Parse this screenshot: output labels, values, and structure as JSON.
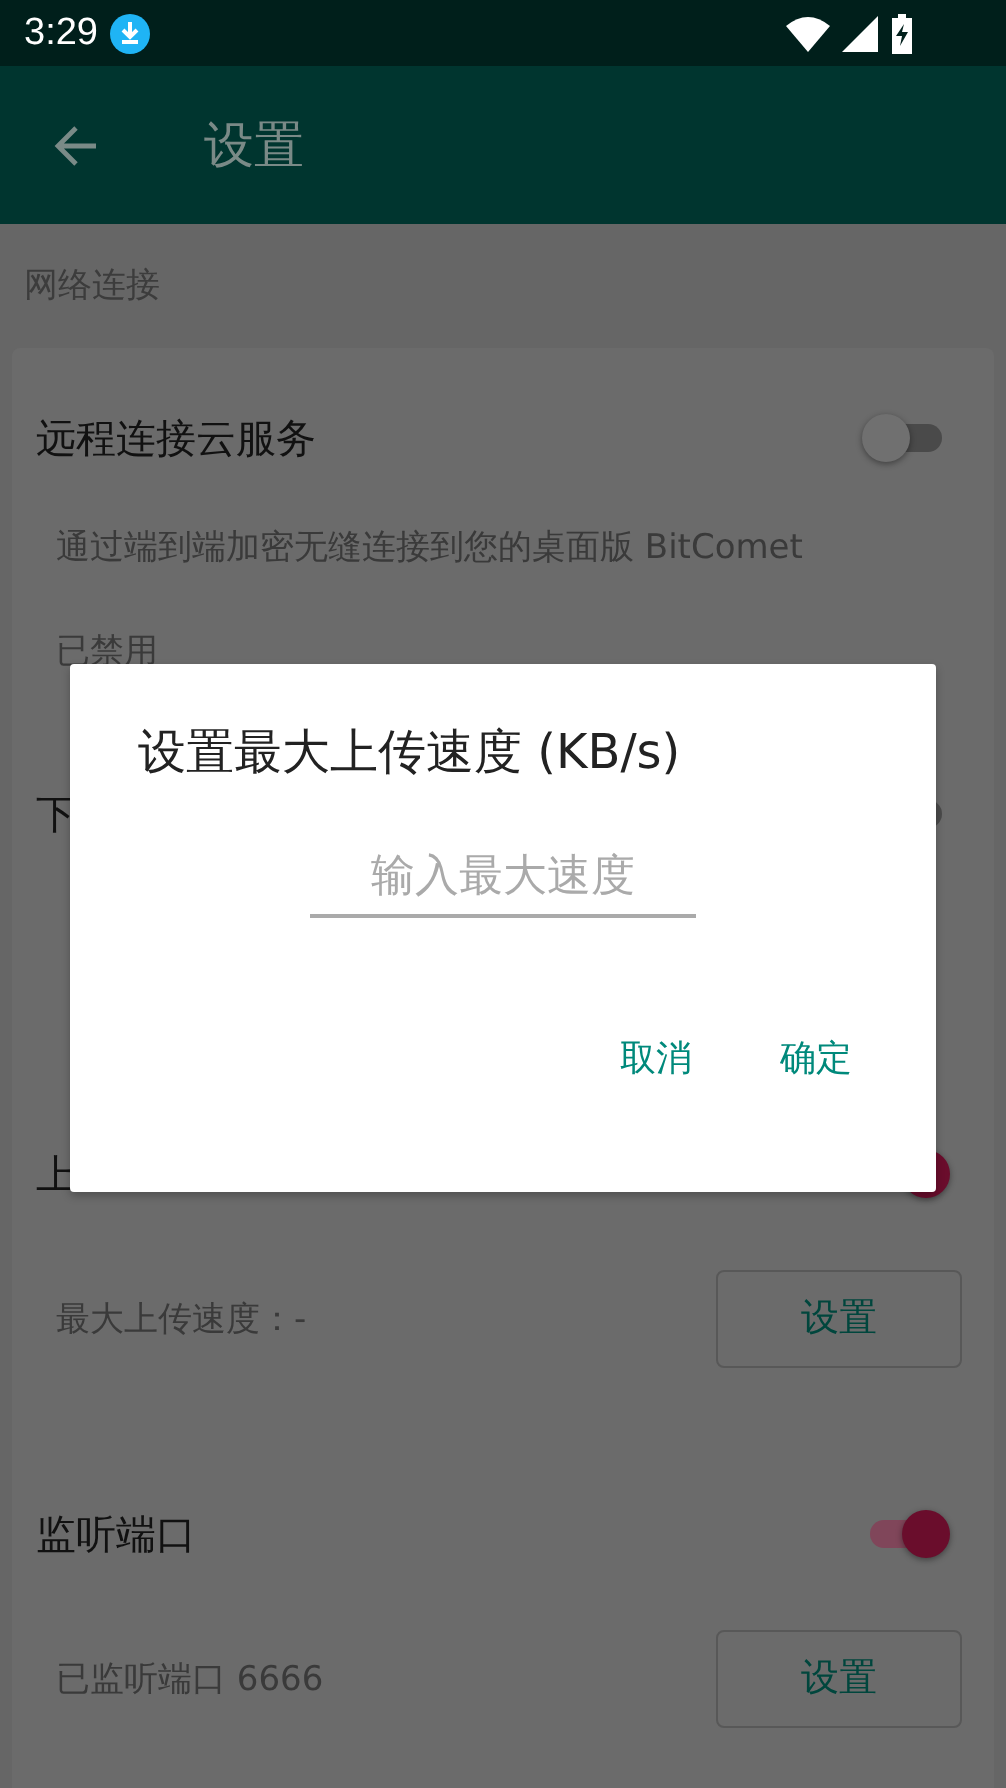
{
  "status_bar": {
    "time": "3:29"
  },
  "app_bar": {
    "title": "设置"
  },
  "section": {
    "header": "网络连接",
    "items": [
      {
        "kind": "switch",
        "title": "远程连接云服务",
        "on": false
      },
      {
        "kind": "text",
        "text": "通过端到端加密无缝连接到您的桌面版 BitComet"
      },
      {
        "kind": "text",
        "text": "已禁用"
      },
      {
        "kind": "switch",
        "title": "下",
        "on": false
      },
      {
        "kind": "setting"
      },
      {
        "kind": "switch",
        "title": "上",
        "on": true
      },
      {
        "kind": "setting",
        "text": "最大上传速度：-",
        "button": "设置"
      },
      {
        "kind": "switch",
        "title": "监听端口",
        "on": true
      },
      {
        "kind": "setting",
        "text": "已监听端口 6666",
        "button": "设置"
      }
    ]
  },
  "dialog": {
    "title": "设置最大上传速度 (KB/s)",
    "placeholder": "输入最大速度",
    "buttons": [
      "取消",
      "确定"
    ]
  }
}
